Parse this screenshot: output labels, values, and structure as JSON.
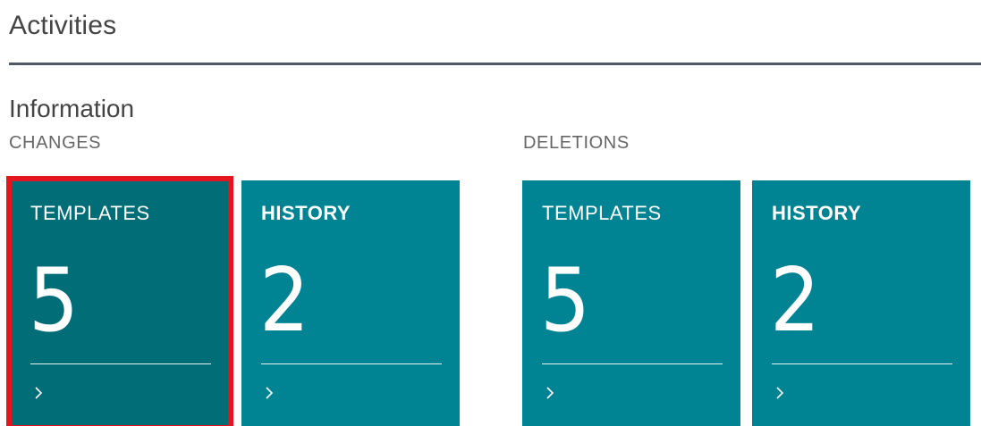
{
  "header": {
    "title": "Activities"
  },
  "section": {
    "title": "Information"
  },
  "groups": [
    {
      "label": "CHANGES",
      "tiles": [
        {
          "label": "TEMPLATES",
          "count": "5",
          "selected": true
        },
        {
          "label": "HISTORY",
          "count": "2",
          "selected": false
        }
      ]
    },
    {
      "label": "DELETIONS",
      "tiles": [
        {
          "label": "TEMPLATES",
          "count": "5",
          "selected": false
        },
        {
          "label": "HISTORY",
          "count": "2",
          "selected": false
        }
      ]
    }
  ],
  "icons": {
    "chevron": "chevron-right-icon"
  },
  "colors": {
    "tile": "#008493",
    "tile_selected": "#006d77",
    "selection_outline": "#e3151f"
  }
}
